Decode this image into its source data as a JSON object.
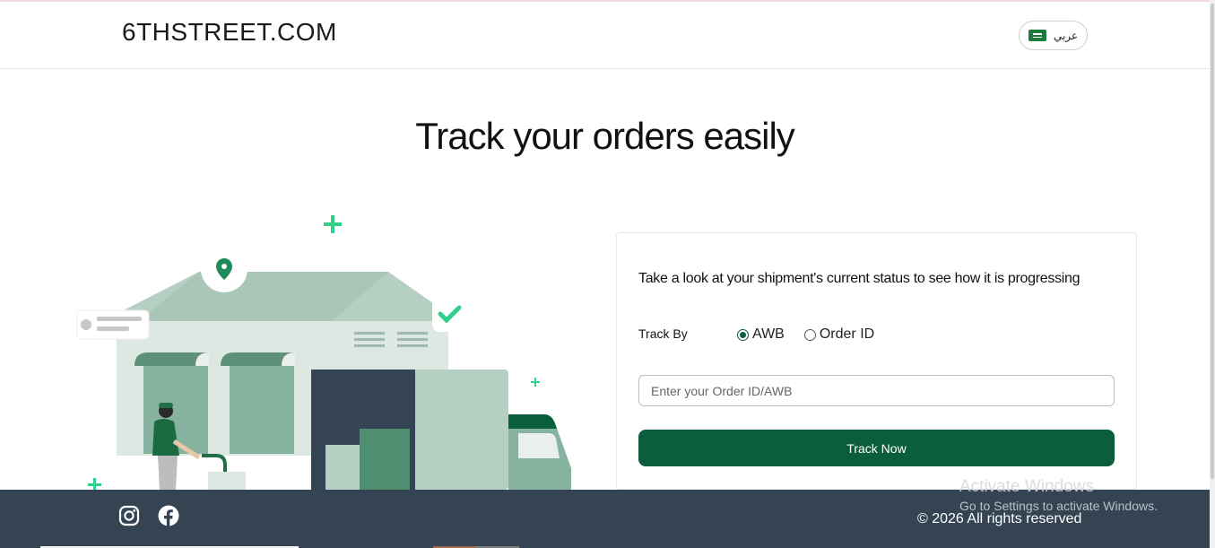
{
  "header": {
    "logo": "6THSTREET.COM",
    "language_label": "عربي",
    "flag_icon": "saudi-flag-icon"
  },
  "main": {
    "title": "Track your orders easily"
  },
  "tracking_card": {
    "description": "Take a look at your shipment's current status to see how it is progressing",
    "track_by_label": "Track By",
    "options": [
      {
        "label": "AWB",
        "selected": true
      },
      {
        "label": "Order ID",
        "selected": false
      }
    ],
    "input_placeholder": "Enter your Order ID/AWB",
    "input_value": "",
    "button_label": "Track Now"
  },
  "footer": {
    "social": [
      "instagram-icon",
      "facebook-icon"
    ],
    "copyright": "© 2026 All rights reserved"
  },
  "watermark": {
    "line1": "Activate Windows",
    "line2": "Go to Settings to activate Windows."
  },
  "colors": {
    "brand_green": "#0b5e3b",
    "footer_bg": "#344452",
    "accent_mint": "#2fd08a",
    "illustration_green": "#b5cfc3"
  }
}
